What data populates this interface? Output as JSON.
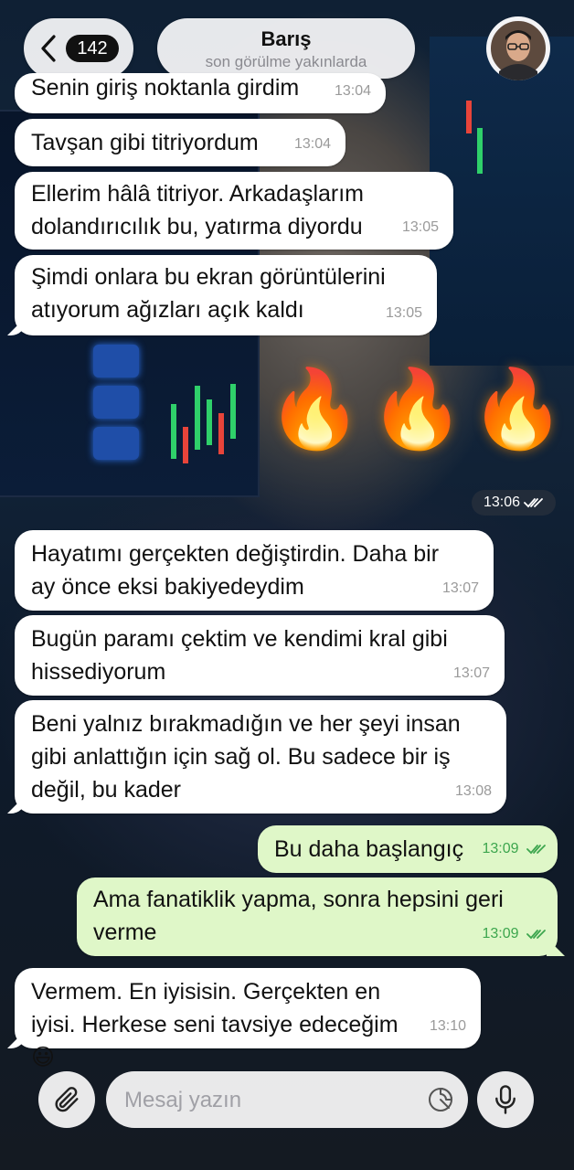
{
  "header": {
    "back_badge": "142",
    "contact_name": "Barış",
    "contact_status": "son görülme yakınlarda"
  },
  "messages": [
    {
      "direction": "in",
      "text": "Senin giriş noktanla girdim",
      "time": "13:04"
    },
    {
      "direction": "in",
      "text": "Tavşan gibi titriyordum",
      "time": "13:04"
    },
    {
      "direction": "in",
      "text": "Ellerim hâlâ titriyor. Arkadaşlarım dolandırıcılık bu, yatırma diyordu",
      "time": "13:05"
    },
    {
      "direction": "in",
      "text": "Şimdi onlara bu ekran görüntülerini atıyorum ağızları açık kaldı",
      "time": "13:05"
    },
    {
      "direction": "out",
      "type": "sticker",
      "text": "🔥🔥🔥",
      "time": "13:06",
      "read": true
    },
    {
      "direction": "in",
      "text": "Hayatımı gerçekten değiştirdin. Daha bir ay önce eksi bakiyedeydim",
      "time": "13:07"
    },
    {
      "direction": "in",
      "text": "Bugün paramı çektim ve kendimi kral gibi hissediyorum",
      "time": "13:07"
    },
    {
      "direction": "in",
      "text": "Beni yalnız bırakmadığın ve her şeyi insan gibi anlattığın için sağ ol. Bu sadece bir iş değil, bu kader",
      "time": "13:08"
    },
    {
      "direction": "out",
      "text": "Bu daha başlangıç",
      "time": "13:09",
      "read": true
    },
    {
      "direction": "out",
      "text": "Ama fanatiklik yapma, sonra hepsini geri verme",
      "time": "13:09",
      "read": true
    },
    {
      "direction": "in",
      "text": "Vermem. En iyisisin. Gerçekten en iyisi. Herkese seni tavsiye edeceğim 😃",
      "time": "13:10"
    }
  ],
  "composer": {
    "placeholder": "Mesaj yazın",
    "value": ""
  },
  "icons": {
    "back": "chevron-left-icon",
    "attach": "paperclip-icon",
    "sticker": "sticker-icon",
    "mic": "microphone-icon",
    "read_receipt": "double-check-icon"
  },
  "colors": {
    "incoming_bubble": "#ffffff",
    "outgoing_bubble": "#dff7c8",
    "outgoing_time": "#3da64e",
    "badge": "#111111"
  }
}
